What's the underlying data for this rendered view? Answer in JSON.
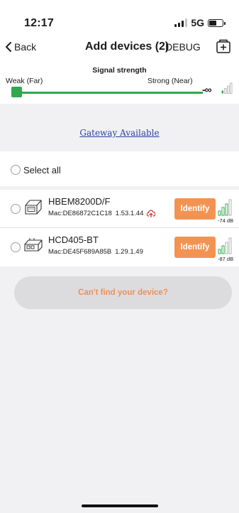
{
  "status_bar": {
    "time": "12:17",
    "network": "5G",
    "signal_bars_active": 3,
    "signal_bars_total": 4,
    "battery_level": 0.6
  },
  "nav": {
    "back_label": "Back",
    "title": "Add devices (2)",
    "debug_label": "DEBUG",
    "back_icon": "chevron-left-icon",
    "add_icon": "add-device-icon"
  },
  "signal_strength": {
    "title": "Signal strength",
    "weak_label": "Weak (Far)",
    "strong_label": "Strong (Near)",
    "threshold_label": "-∞",
    "threshold_bars": 1,
    "slider_level": 0.0,
    "accent_color": "#2fa84f"
  },
  "gateway": {
    "label": "Gateway Available",
    "color": "#2a3f9e"
  },
  "select_all": {
    "label": "Select all"
  },
  "devices": [
    {
      "name": "HBEM8200D/F",
      "mac": "Mac:DE86872C1C18",
      "version": "1.53.1.44",
      "firmware_update_icon": "cloud-upload-icon",
      "identify_label": "Identify",
      "rssi": "-74 dB",
      "signal_bars": 3
    },
    {
      "name": "HCD405-BT",
      "mac": "Mac:DE45F689A85B",
      "version": "1.29.1.49",
      "identify_label": "Identify",
      "rssi": "-87 dB",
      "signal_bars": 2
    }
  ],
  "cant_find": {
    "label": "Can't find your device?"
  },
  "colors": {
    "identify_button": "#f39352",
    "cant_find_text": "#ee8f5c",
    "firmware_icon": "#d9302f"
  }
}
